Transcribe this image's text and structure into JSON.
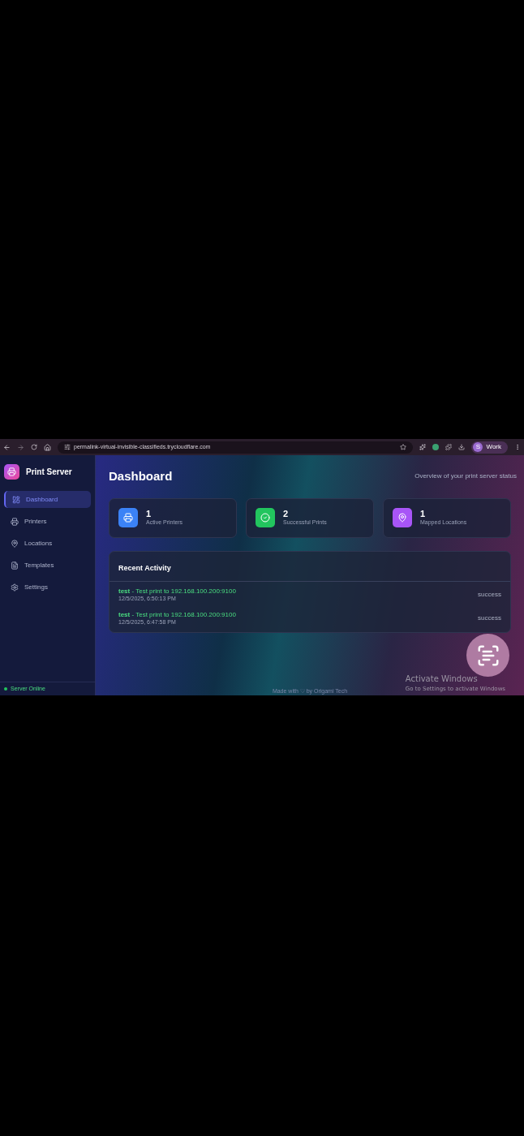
{
  "browser": {
    "url": "permalink-virtual-invisible-classifieds.trycloudflare.com",
    "profile": {
      "initial": "S",
      "name": "Work"
    }
  },
  "sidebar": {
    "brand": "Print Server",
    "items": [
      {
        "label": "Dashboard",
        "selected": true
      },
      {
        "label": "Printers",
        "selected": false
      },
      {
        "label": "Locations",
        "selected": false
      },
      {
        "label": "Templates",
        "selected": false
      },
      {
        "label": "Settings",
        "selected": false
      }
    ],
    "status": {
      "label": "Server Online",
      "online": true
    }
  },
  "header": {
    "title": "Dashboard",
    "subtitle": "Overview of your print server status"
  },
  "stats": [
    {
      "value": "1",
      "label": "Active Printers",
      "kind": "printers"
    },
    {
      "value": "2",
      "label": "Successful Prints",
      "kind": "success"
    },
    {
      "value": "1",
      "label": "Mapped Locations",
      "kind": "locations"
    }
  ],
  "activity": {
    "title": "Recent Activity",
    "items": [
      {
        "message": "**test** - Test print to 192.168.100.200:9100",
        "time": "12/5/2025, 6:50:13 PM",
        "status": "success"
      },
      {
        "message": "**test** - Test print to 192.168.100.200:9100",
        "time": "12/5/2025, 6:47:58 PM",
        "status": "success"
      }
    ]
  },
  "footer": "Made with ♡ by Origami Tech",
  "system_notice": {
    "title": "Activate Windows",
    "subtitle": "Go to Settings to activate Windows"
  }
}
